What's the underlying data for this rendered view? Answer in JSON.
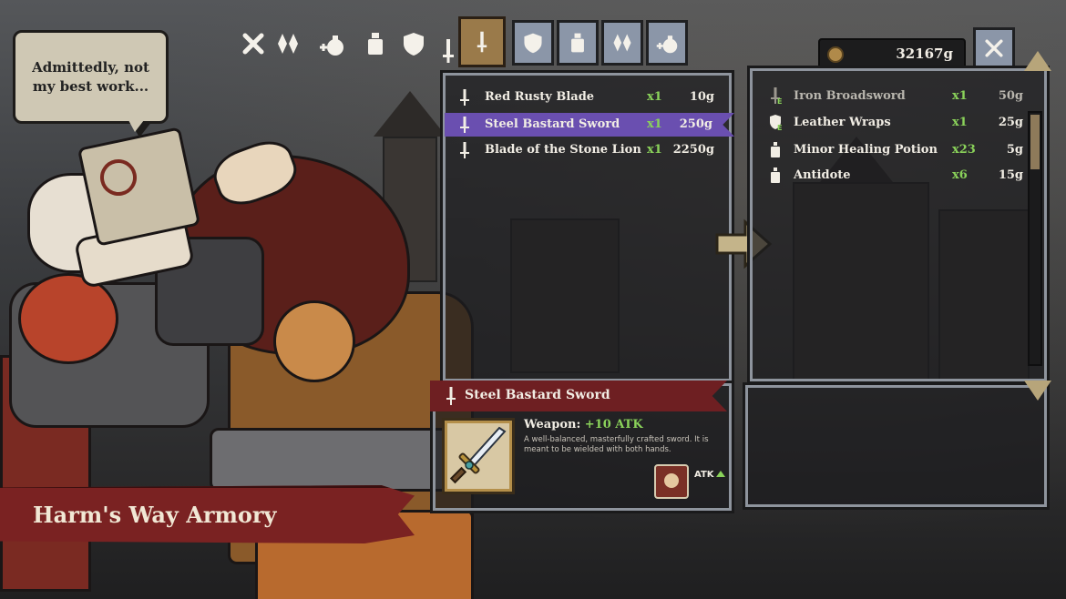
{
  "speech": {
    "line1": "Admittedly, not",
    "line2": "my best work..."
  },
  "store": {
    "name": "Harm's Way Armory"
  },
  "categories": [
    {
      "name": "all",
      "icon": "cross-icon"
    },
    {
      "name": "trinkets",
      "icon": "crystals-icon"
    },
    {
      "name": "consumables",
      "icon": "bomb-icon"
    },
    {
      "name": "potions",
      "icon": "bottle-icon"
    },
    {
      "name": "armor",
      "icon": "shield-icon"
    },
    {
      "name": "weapons",
      "icon": "sword-icon"
    }
  ],
  "tabs": [
    {
      "name": "weapons",
      "icon": "sword-icon",
      "active": true
    },
    {
      "name": "armor",
      "icon": "shield-icon",
      "active": false
    },
    {
      "name": "potions",
      "icon": "bottle-icon",
      "active": false
    },
    {
      "name": "trinkets",
      "icon": "crystals-icon",
      "active": false
    },
    {
      "name": "consumables",
      "icon": "bomb-icon",
      "active": false
    }
  ],
  "gold": "32167g",
  "shop_items": [
    {
      "name": "Red Rusty Blade",
      "qty": "x1",
      "price": "10g",
      "icon": "sword-icon",
      "selected": false
    },
    {
      "name": "Steel Bastard Sword",
      "qty": "x1",
      "price": "250g",
      "icon": "sword-icon",
      "selected": true
    },
    {
      "name": "Blade of the Stone Lion",
      "qty": "x1",
      "price": "2250g",
      "icon": "sword-icon",
      "selected": false
    }
  ],
  "inventory_items": [
    {
      "name": "Iron Broadsword",
      "qty": "x1",
      "price": "50g",
      "icon": "sword-icon",
      "equipped": true,
      "badge": "E"
    },
    {
      "name": "Leather Wraps",
      "qty": "x1",
      "price": "25g",
      "icon": "shield-icon",
      "equipped": true,
      "badge": "E"
    },
    {
      "name": "Minor Healing Potion",
      "qty": "x23",
      "price": "5g",
      "icon": "bottle-icon",
      "equipped": false
    },
    {
      "name": "Antidote",
      "qty": "x6",
      "price": "15g",
      "icon": "bottle-icon",
      "equipped": false
    }
  ],
  "detail": {
    "name": "Steel Bastard Sword",
    "type_label": "Weapon:",
    "bonus": "+10 ATK",
    "description": "A well-balanced, masterfully crafted sword.  It is meant to be wielded with both hands.",
    "stat": "ATK"
  },
  "colors": {
    "accent_green": "#8ad25a",
    "selection_purple": "#6a4fb0",
    "banner_red": "#7a2222",
    "tab_active": "#9a7a4a",
    "tab": "#8b96a8"
  }
}
